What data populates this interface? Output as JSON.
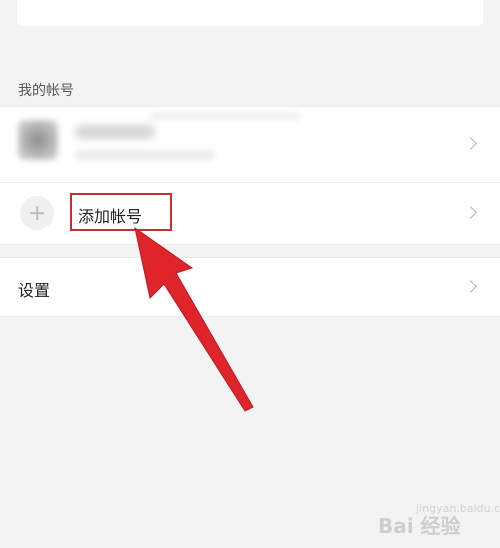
{
  "my_accounts_section": {
    "label": "我的帐号"
  },
  "add_account": {
    "label": "添加帐号"
  },
  "settings": {
    "label": "设置"
  },
  "watermark": {
    "text": "Bai 经验",
    "sub": "jingyan.baidu.com"
  },
  "colors": {
    "background": "#f3f3f3",
    "card": "#ffffff",
    "highlight": "#c62f2f",
    "arrow": "#e0242b"
  },
  "icons": {
    "chevron": "chevron-right-icon",
    "add": "plus-icon"
  }
}
